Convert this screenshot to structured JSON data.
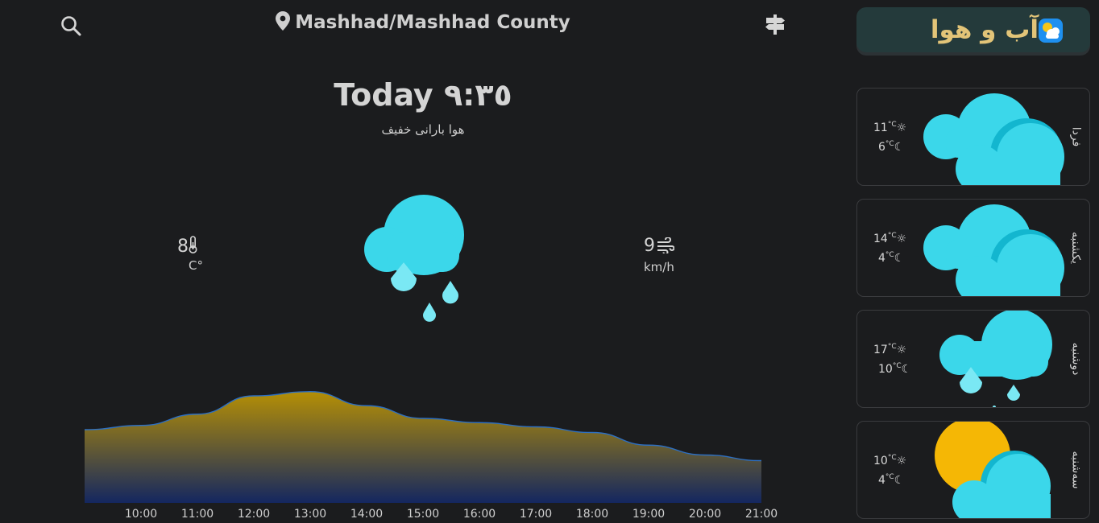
{
  "header": {
    "location": "Mashhad/Mashhad County"
  },
  "current": {
    "title": "Today ٩:٣٥",
    "description": "هوا بارانی خفیف",
    "temperature": "8",
    "temperature_unit": "C°",
    "wind": "9",
    "wind_unit": "km/h"
  },
  "brand": {
    "title": "آب و هوا"
  },
  "hourly": {
    "ticks": [
      "10:00",
      "11:00",
      "12:00",
      "13:00",
      "14:00",
      "15:00",
      "16:00",
      "17:00",
      "18:00",
      "19:00",
      "20:00",
      "21:00"
    ]
  },
  "chart_data": {
    "type": "area",
    "x": [
      "09:00",
      "10:00",
      "11:00",
      "12:00",
      "13:00",
      "14:00",
      "15:00",
      "16:00",
      "17:00",
      "18:00",
      "19:00",
      "20:00",
      "21:00"
    ],
    "y": [
      5.2,
      5.5,
      6.3,
      7.6,
      7.9,
      6.9,
      6.0,
      5.7,
      5.4,
      5.0,
      4.1,
      3.4,
      3.0
    ],
    "ylim": [
      0,
      10
    ],
    "grid": false,
    "colors": {
      "top": "#b58f05",
      "bottom": "#142760",
      "line": "#2d6fc2"
    }
  },
  "forecast": [
    {
      "day": "فردا",
      "high": "11",
      "low": "6",
      "icon": "cloudy-icon"
    },
    {
      "day": "یکشنبه",
      "high": "14",
      "low": "4",
      "icon": "cloudy-icon"
    },
    {
      "day": "دوشنبه",
      "high": "17",
      "low": "10",
      "icon": "rain-icon"
    },
    {
      "day": "سه‌شنبه",
      "high": "10",
      "low": "4",
      "icon": "partly-sunny-icon"
    }
  ],
  "temp_unit_small": "°C",
  "colors": {
    "background": "#1b1c1e",
    "cloud": "#3bd7ea",
    "cloud_shade": "#13b6cf",
    "drop": "#7ae8f4",
    "sun": "#f5b705",
    "brand_text": "#e2c478"
  }
}
